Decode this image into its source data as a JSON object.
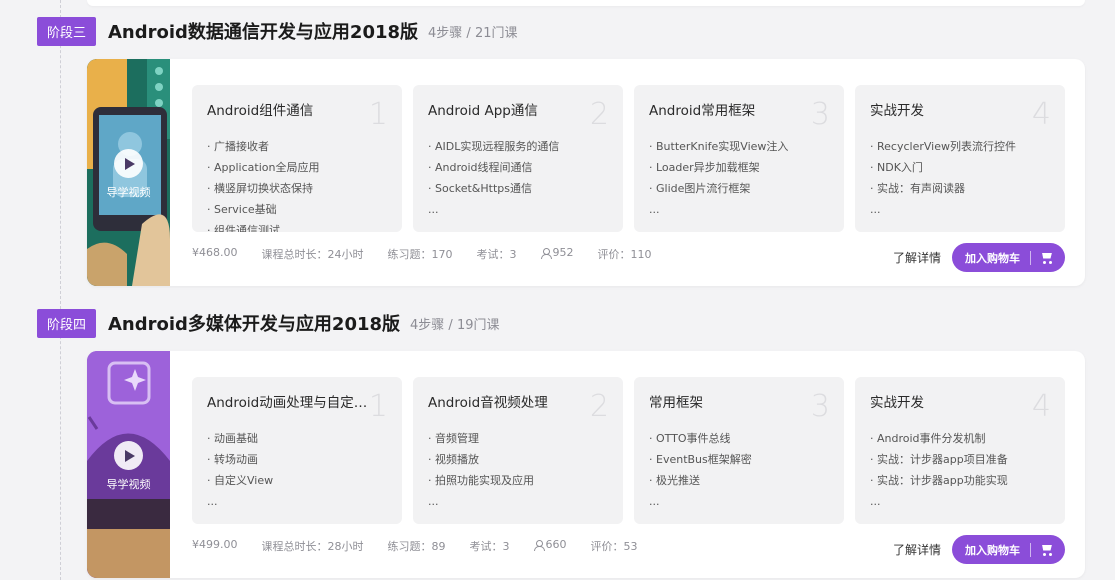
{
  "stages": [
    {
      "badge": "阶段三",
      "title": "Android数据通信开发与应用2018版",
      "meta": "4步骤 / 21门课",
      "video_label": "导学视频",
      "steps": [
        {
          "title": "Android组件通信",
          "num": "1",
          "items": [
            "· 广播接收者",
            "· Application全局应用",
            "· 横竖屏切换状态保持",
            "· Service基础",
            "· 组件通信测试"
          ]
        },
        {
          "title": "Android App通信",
          "num": "2",
          "items": [
            "· AIDL实现远程服务的通信",
            "· Android线程间通信",
            "· Socket&Https通信",
            "..."
          ]
        },
        {
          "title": "Android常用框架",
          "num": "3",
          "items": [
            "· ButterKnife实现View注入",
            "· Loader异步加载框架",
            "· Glide图片流行框架",
            "..."
          ]
        },
        {
          "title": "实战开发",
          "num": "4",
          "items": [
            "· RecyclerView列表流行控件",
            "· NDK入门",
            "· 实战：有声阅读器",
            "..."
          ]
        }
      ],
      "price": "¥468.00",
      "duration": "课程总时长：24小时",
      "exercises": "练习题：170",
      "exams": "考试：3",
      "students": "952",
      "rating": "评价：110",
      "detail": "了解详情",
      "cart": "加入购物车"
    },
    {
      "badge": "阶段四",
      "title": "Android多媒体开发与应用2018版",
      "meta": "4步骤 / 19门课",
      "video_label": "导学视频",
      "steps": [
        {
          "title": "Android动画处理与自定义...",
          "num": "1",
          "items": [
            "· 动画基础",
            "· 转场动画",
            "· 自定义View",
            "..."
          ]
        },
        {
          "title": "Android音视频处理",
          "num": "2",
          "items": [
            "· 音频管理",
            "· 视频播放",
            "· 拍照功能实现及应用",
            "..."
          ]
        },
        {
          "title": "常用框架",
          "num": "3",
          "items": [
            "· OTTO事件总线",
            "· EventBus框架解密",
            "· 极光推送",
            "..."
          ]
        },
        {
          "title": "实战开发",
          "num": "4",
          "items": [
            "· Android事件分发机制",
            "· 实战：计步器app项目准备",
            "· 实战：计步器app功能实现",
            "..."
          ]
        }
      ],
      "price": "¥499.00",
      "duration": "课程总时长：28小时",
      "exercises": "练习题：89",
      "exams": "考试：3",
      "students": "660",
      "rating": "评价：53",
      "detail": "了解详情",
      "cart": "加入购物车"
    }
  ],
  "colors": {
    "accent": "#8b4dd9",
    "thumb3": "#1f6b5c",
    "thumb4": "#9a5fd6"
  },
  "icons": {
    "play": "play-icon",
    "user": "user-icon",
    "cart": "cart-icon"
  }
}
